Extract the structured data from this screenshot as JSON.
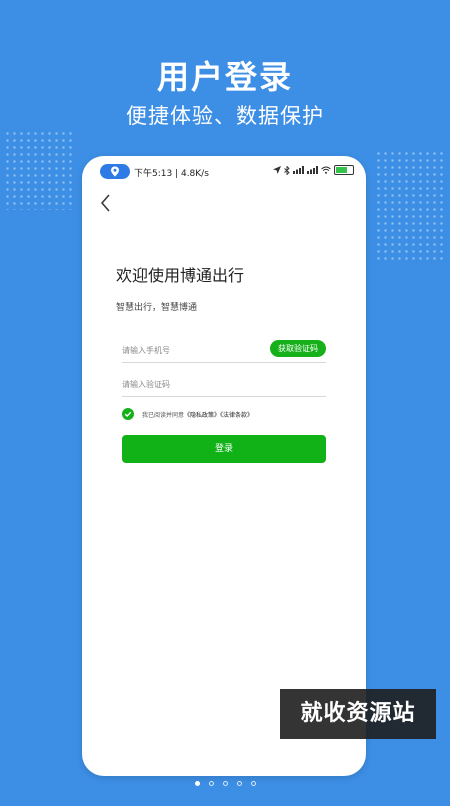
{
  "promo": {
    "headline": "用户登录",
    "subline": "便捷体验、数据保护"
  },
  "statusbar": {
    "time_speed": "下午5:13 | 4.8K/s",
    "icons": [
      "location-arrow-icon",
      "bluetooth-icon",
      "signal-icon",
      "signal-icon",
      "wifi-icon",
      "battery-icon"
    ]
  },
  "login": {
    "title": "欢迎使用博通出行",
    "subtitle": "智慧出行，智慧博通",
    "phone_placeholder": "请输入手机号",
    "code_placeholder": "请输入验证码",
    "get_code_label": "获取验证码",
    "agree_prefix": "我已阅读并同意",
    "privacy_link": "《隐私政策》",
    "law_link": "《法律条款》",
    "login_label": "登录"
  },
  "watermark": "就收资源站",
  "pager": {
    "total": 5,
    "active": 0
  },
  "colors": {
    "background": "#3d8fe6",
    "accent_green": "#16b01a",
    "location_pill": "#2f7be5"
  }
}
